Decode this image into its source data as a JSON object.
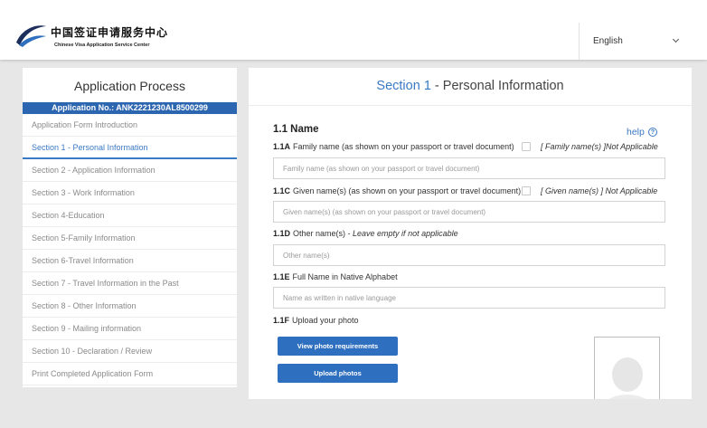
{
  "header": {
    "logo_cn": "中国签证申请服务中心",
    "logo_en": "Chinese Visa Application Service Center",
    "logo_icon": "swoosh-logo-icon",
    "language": "English",
    "language_icon": "chevron-down-icon"
  },
  "sidebar": {
    "title": "Application Process",
    "application_no": "Application No.: ANK2221230AL8500299",
    "active_index": 1,
    "items": [
      "Application Form Introduction",
      "Section 1 - Personal Information",
      "Section 2 - Application Information",
      "Section 3 - Work Information",
      "Section 4-Education",
      "Section 5-Family Information",
      "Section 6-Travel Information",
      "Section 7 - Travel Information in the Past",
      "Section 8 - Other Information",
      "Section 9 - Mailing information",
      "Section 10 - Declaration / Review",
      "Print Completed Application Form"
    ]
  },
  "main": {
    "heading_section": "Section 1",
    "heading_rest": " - Personal Information",
    "subsection": "1.1 Name",
    "help_label": "help",
    "help_icon": "question-circle-icon",
    "family_name": {
      "num": "1.1A",
      "label": "Family name (as shown on your passport or travel document)",
      "not_applicable": "[ Family name(s) ]Not Applicable",
      "not_applicable_checked": false,
      "value": "",
      "placeholder": "Family name (as shown on your passport or travel document)"
    },
    "given_name": {
      "num": "1.1C",
      "label": "Given name(s) (as shown on your passport or travel document)",
      "not_applicable": "[ Given name(s) ] Not Applicable",
      "not_applicable_checked": false,
      "value": "",
      "placeholder": "Given name(s) (as shown on your passport or travel document)"
    },
    "other_name": {
      "num": "1.1D",
      "label": "Other name(s) - ",
      "hint": "Leave empty if not applicable",
      "value": "",
      "placeholder": "Other name(s)"
    },
    "native_name": {
      "num": "1.1E",
      "label": "Full Name in Native Alphabet",
      "value": "",
      "placeholder": "Name as written in native language"
    },
    "photo": {
      "num": "1.1F",
      "label": "Upload your photo",
      "view_requirements_button": "View photo requirements",
      "upload_button": "Upload photos",
      "preview_icon": "person-silhouette-icon"
    }
  },
  "colors": {
    "accent": "#3a79c3",
    "button": "#2f6fbf",
    "application_bar": "#2c66b0",
    "background": "#e7e7e7"
  }
}
